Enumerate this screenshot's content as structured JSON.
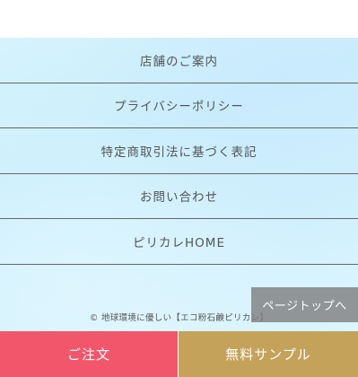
{
  "footer_menu": {
    "items": [
      {
        "label": "店舗のご案内"
      },
      {
        "label": "プライバシーポリシー"
      },
      {
        "label": "特定商取引法に基づく表記"
      },
      {
        "label": "お問い合わせ"
      },
      {
        "label": "ピリカレHOME"
      }
    ]
  },
  "copyright": "© 地球環境に優しい【エコ粉石鹸ピリカレ】",
  "page_top_label": "ページトップへ",
  "bottom_bar": {
    "order_label": "ご注文",
    "sample_label": "無料サンプル"
  },
  "colors": {
    "footer_background": "#cdeffc",
    "order_button": "#f2566a",
    "sample_button": "#c4a25a",
    "page_top_button": "#808080"
  }
}
